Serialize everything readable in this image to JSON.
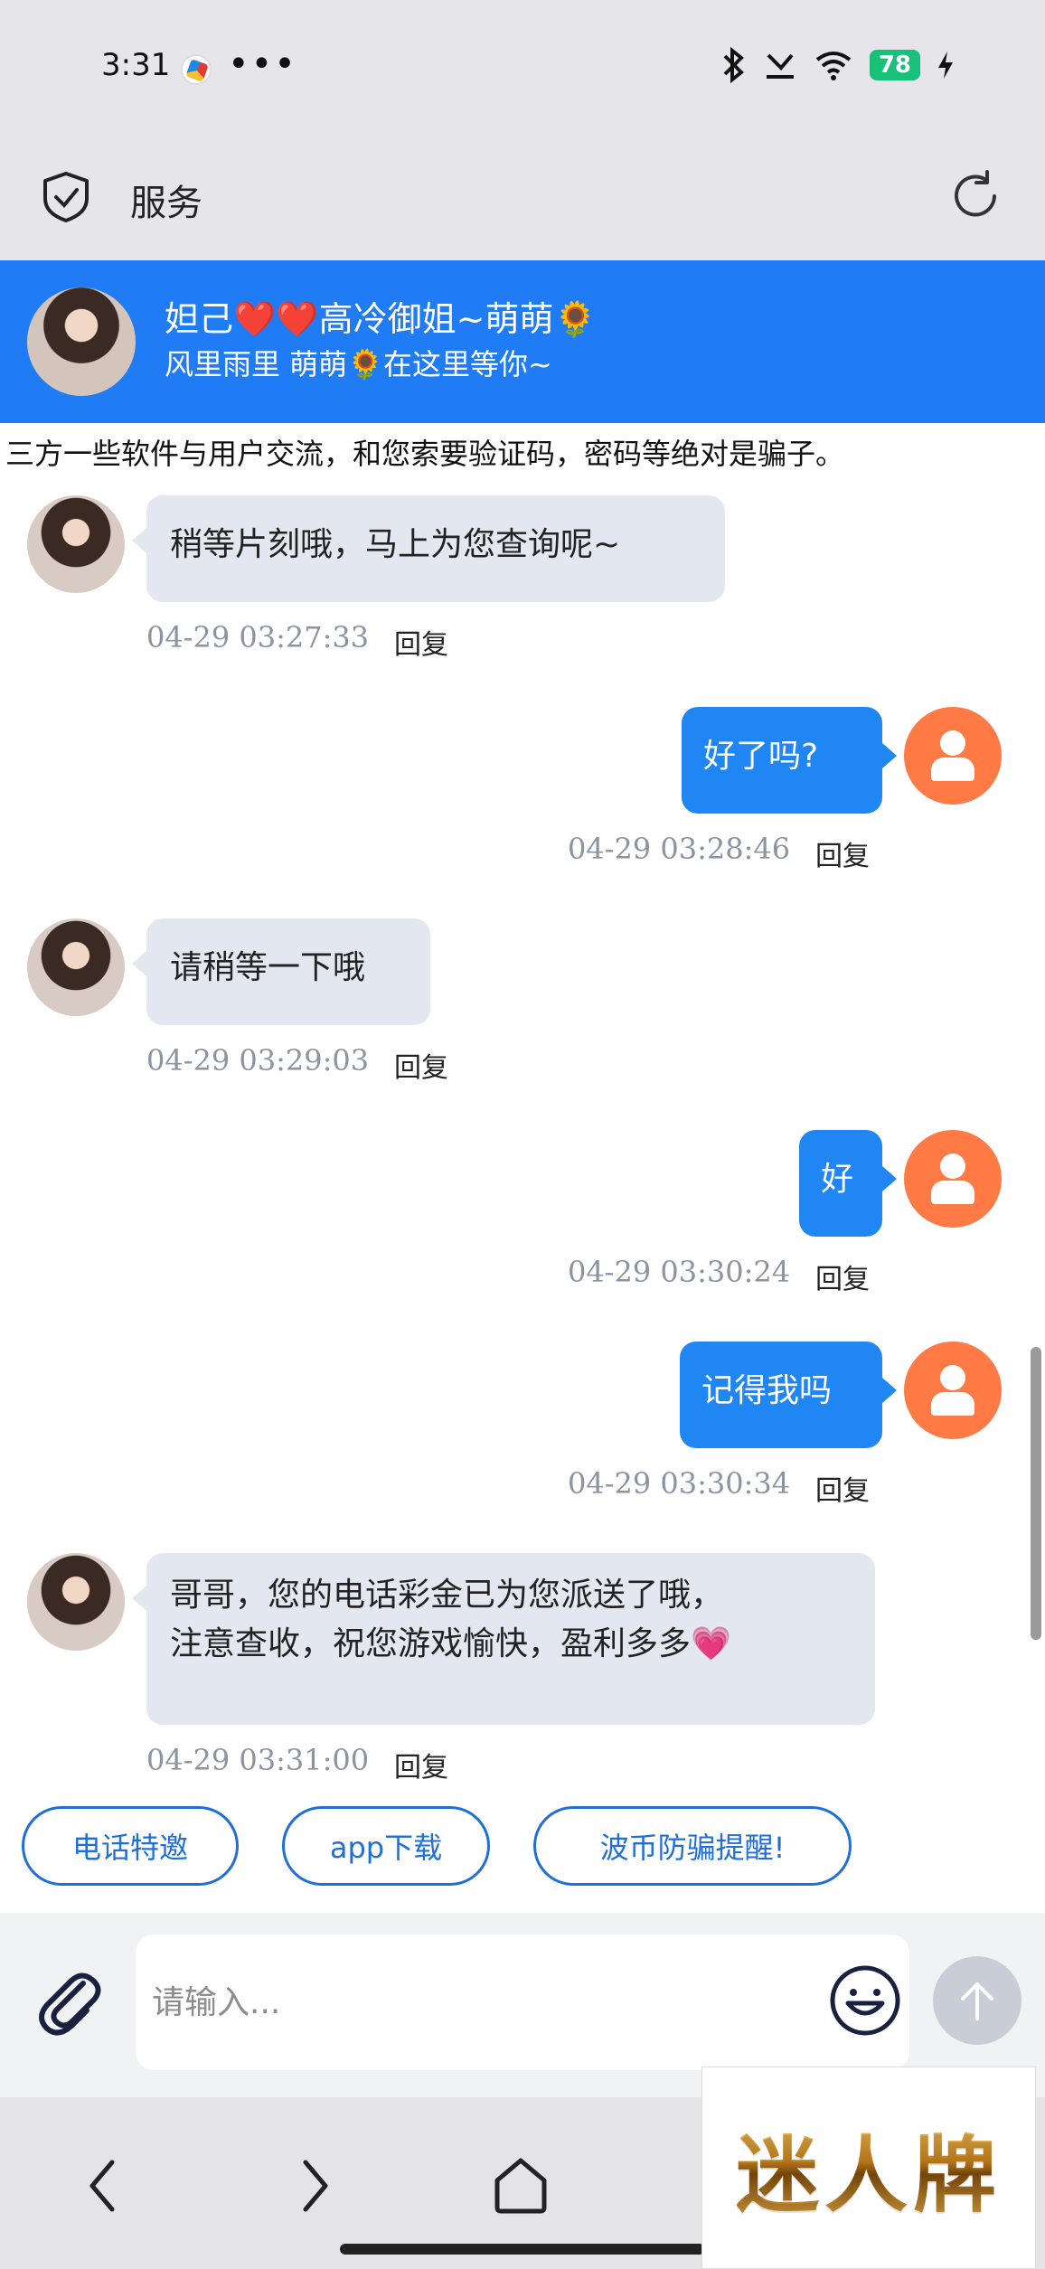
{
  "status_bar": {
    "time": "3:31",
    "dots": "•••",
    "battery": "78"
  },
  "header": {
    "title": "服务"
  },
  "agent": {
    "name": "妲己❤️❤️高冷御姐~萌萌🌻",
    "tagline": "风里雨里 萌萌🌻在这里等你~"
  },
  "notice": "三方一些软件与用户交流，和您索要验证码，密码等绝对是骗子。",
  "messages": [
    {
      "from": "agent",
      "text": "稍等片刻哦，马上为您查询呢~",
      "time": "04-29 03:27:33",
      "reply": "回复"
    },
    {
      "from": "user",
      "text": "好了吗?",
      "time": "04-29 03:28:46",
      "reply": "回复"
    },
    {
      "from": "agent",
      "text": "请稍等一下哦",
      "time": "04-29 03:29:03",
      "reply": "回复"
    },
    {
      "from": "user",
      "text": "好",
      "time": "04-29 03:30:24",
      "reply": "回复"
    },
    {
      "from": "user",
      "text": "记得我吗",
      "time": "04-29 03:30:34",
      "reply": "回复"
    },
    {
      "from": "agent",
      "text_line1": "哥哥，您的电话彩金已为您派送了哦，",
      "text_line2": "注意查收，祝您游戏愉快，盈利多多💗",
      "time": "04-29 03:31:00",
      "reply": "回复"
    }
  ],
  "quick_actions": [
    "电话特邀",
    "app下载",
    "波币防骗提醒!"
  ],
  "input": {
    "placeholder": "请输入..."
  },
  "brand": {
    "text": "迷人牌"
  },
  "colors": {
    "accent": "#1f7cf5",
    "user_avatar": "#ff7a45",
    "battery": "#19c07a"
  }
}
